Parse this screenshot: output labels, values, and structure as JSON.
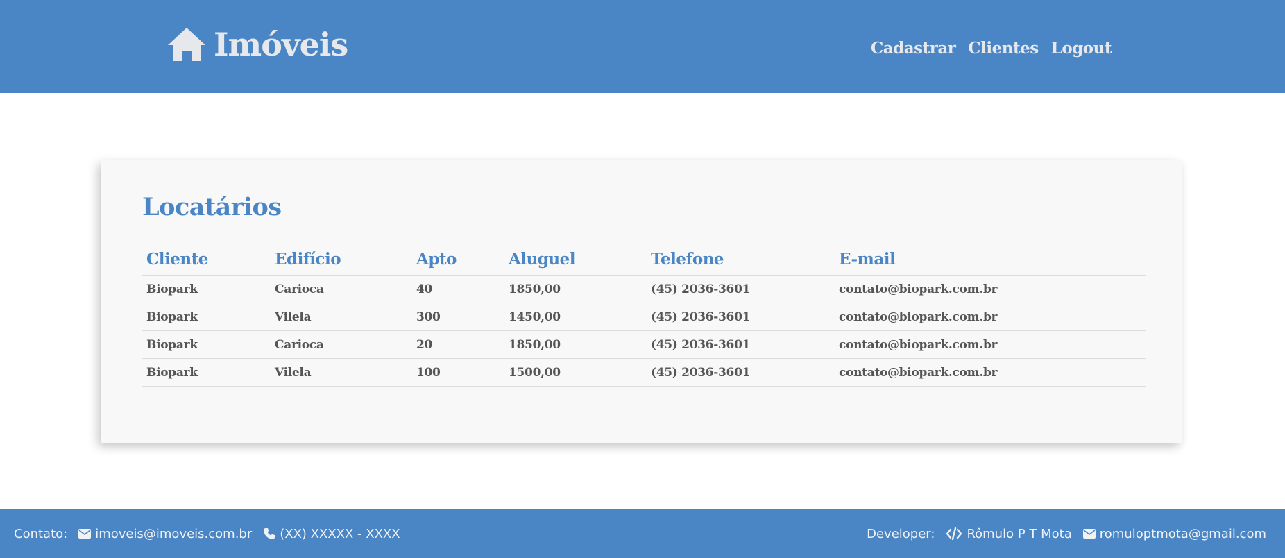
{
  "header": {
    "brand": "Imóveis",
    "nav": [
      "Cadastrar",
      "Clientes",
      "Logout"
    ]
  },
  "main": {
    "title": "Locatários",
    "columns": [
      "Cliente",
      "Edifício",
      "Apto",
      "Aluguel",
      "Telefone",
      "E-mail"
    ],
    "rows": [
      [
        "Biopark",
        "Carioca",
        "40",
        "1850,00",
        "(45) 2036-3601",
        "contato@biopark.com.br"
      ],
      [
        "Biopark",
        "Vilela",
        "300",
        "1450,00",
        "(45) 2036-3601",
        "contato@biopark.com.br"
      ],
      [
        "Biopark",
        "Carioca",
        "20",
        "1850,00",
        "(45) 2036-3601",
        "contato@biopark.com.br"
      ],
      [
        "Biopark",
        "Vilela",
        "100",
        "1500,00",
        "(45) 2036-3601",
        "contato@biopark.com.br"
      ]
    ]
  },
  "footer": {
    "contact_label": "Contato:",
    "contact_email": "imoveis@imoveis.com.br",
    "contact_phone": "(XX) XXXXX - XXXX",
    "developer_label": "Developer:",
    "developer_name": "Rômulo P T Mota",
    "developer_email": "romuloptmota@gmail.com"
  },
  "icons": {
    "brand": "home-icon",
    "contact_email": "envelope-icon",
    "contact_phone": "phone-icon",
    "developer_name": "code-icon",
    "developer_email": "envelope-icon"
  },
  "colors": {
    "brand_blue": "#4a86c5",
    "header_text": "#e6e8ec",
    "card_bg": "#f8f8f8",
    "cell_text": "#555555"
  }
}
